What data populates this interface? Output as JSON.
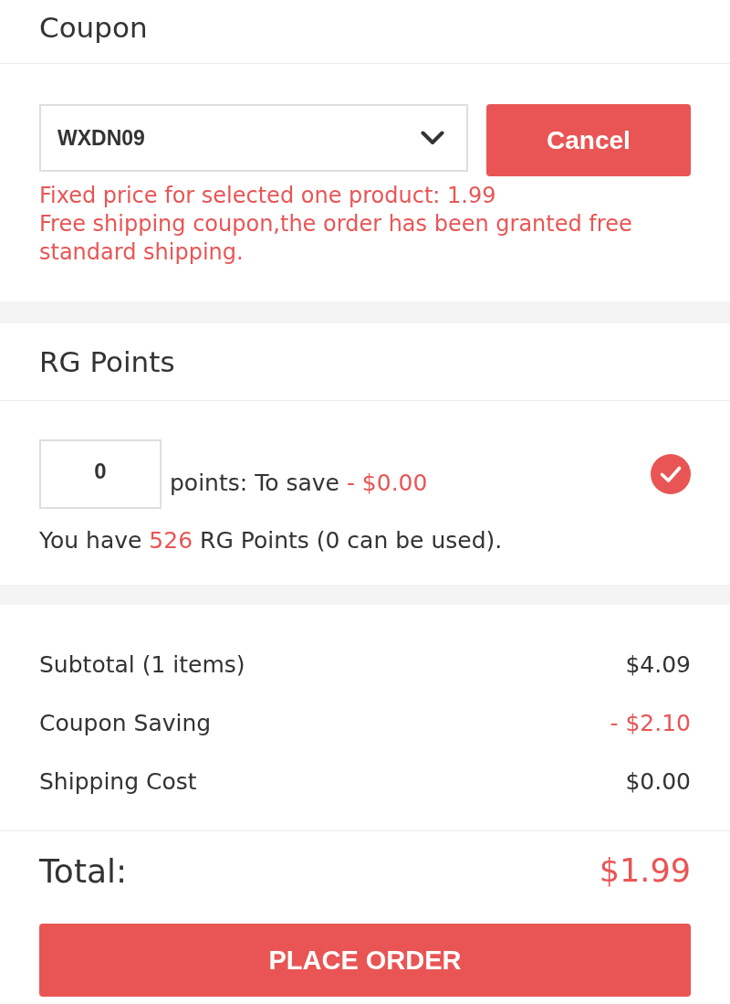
{
  "coupon": {
    "title": "Coupon",
    "select": {
      "value": "WXDN09"
    },
    "cancel_button": "Cancel",
    "messages": [
      "Fixed price for selected one product: 1.99",
      "Free shipping coupon,the order has been granted free standard shipping."
    ]
  },
  "rg_points": {
    "title": "RG Points",
    "input": {
      "value": "0"
    },
    "save_label": "points: To save",
    "save_amount": "- $0.00",
    "checked": true,
    "balance": {
      "prefix": "You have",
      "points": "526",
      "suffix": "RG Points (0 can be used)."
    }
  },
  "summary": {
    "rows": [
      {
        "label": "Subtotal (1 items)",
        "value": "$4.09",
        "kind": "amount"
      },
      {
        "label": "Coupon Saving",
        "value": "- $2.10",
        "kind": "discount"
      },
      {
        "label": "Shipping Cost",
        "value": "$0.00",
        "kind": "amount"
      }
    ]
  },
  "total": {
    "label": "Total:",
    "value": "$1.99"
  },
  "place_order_button": "PLACE ORDER"
}
